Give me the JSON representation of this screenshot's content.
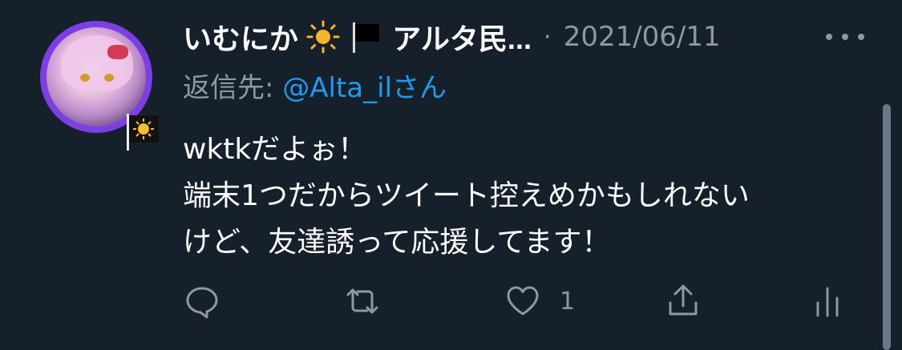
{
  "tweet": {
    "author_name": "いむにか",
    "author_name_suffix": "アルタ民...",
    "separator": "·",
    "date": "2021/06/11",
    "reply_prefix": "返信先: ",
    "reply_handle": "@Alta_il",
    "reply_suffix": "さん",
    "body_lines": [
      "wktkだよぉ！",
      "端末1つだからツイート控えめかもしれない",
      "けど、友達誘って応援してます！"
    ],
    "like_count": "1"
  },
  "icons": {
    "sun": "sun-emoji-icon",
    "flag": "black-flag-emoji-icon",
    "more": "more-options-icon",
    "reply": "reply-icon",
    "retweet": "retweet-icon",
    "like": "heart-icon",
    "share": "share-icon",
    "analytics": "analytics-icon"
  },
  "colors": {
    "background": "#15202b",
    "text_primary": "#ffffff",
    "text_secondary": "#8b98a5",
    "mention": "#1d9bf0",
    "avatar_ring": "#7b3fe4"
  }
}
